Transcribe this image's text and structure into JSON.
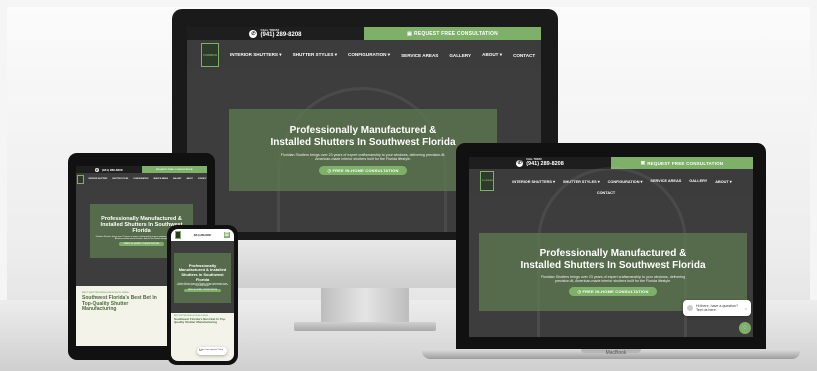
{
  "site": {
    "phone_label": "CALL TODAY",
    "phone": "(941) 289-8208",
    "consult_btn": "REQUEST FREE CONSULTATION",
    "logo_text": "FLORIDIAN",
    "nav": [
      "INTERIOR SHUTTERS",
      "SHUTTER STYLES",
      "CONFIGURATION",
      "SERVICE AREAS",
      "GALLERY",
      "ABOUT",
      "CONTACT"
    ],
    "hero_title_line1": "Professionally Manufactured &",
    "hero_title_line2": "Installed Shutters In Southwest Florida",
    "hero_subtitle": "Floridian Shutters brings over 23 years of expert craftsmanship to your windows, delivering precision-fit, American-made interior shutters built for the Florida lifestyle.",
    "hero_cta": "FREE IN-HOME CONSULTATION",
    "section_eyebrow": "BEST SHUTTER INSTALLER IN SW FLORIDA",
    "section_title": "Southwest Florida's Best Bet In Top-Quality Shutter Manufacturing",
    "section_title_phone": "Southwest Florida's Best Bet In Top-Quality Shutter Manufacturing"
  },
  "chat": {
    "message": "Hi there, have a question? Text us here."
  },
  "device": {
    "laptop_brand": "MacBook"
  },
  "colors": {
    "accent": "#7fb069",
    "dark": "#1e1e1e"
  }
}
